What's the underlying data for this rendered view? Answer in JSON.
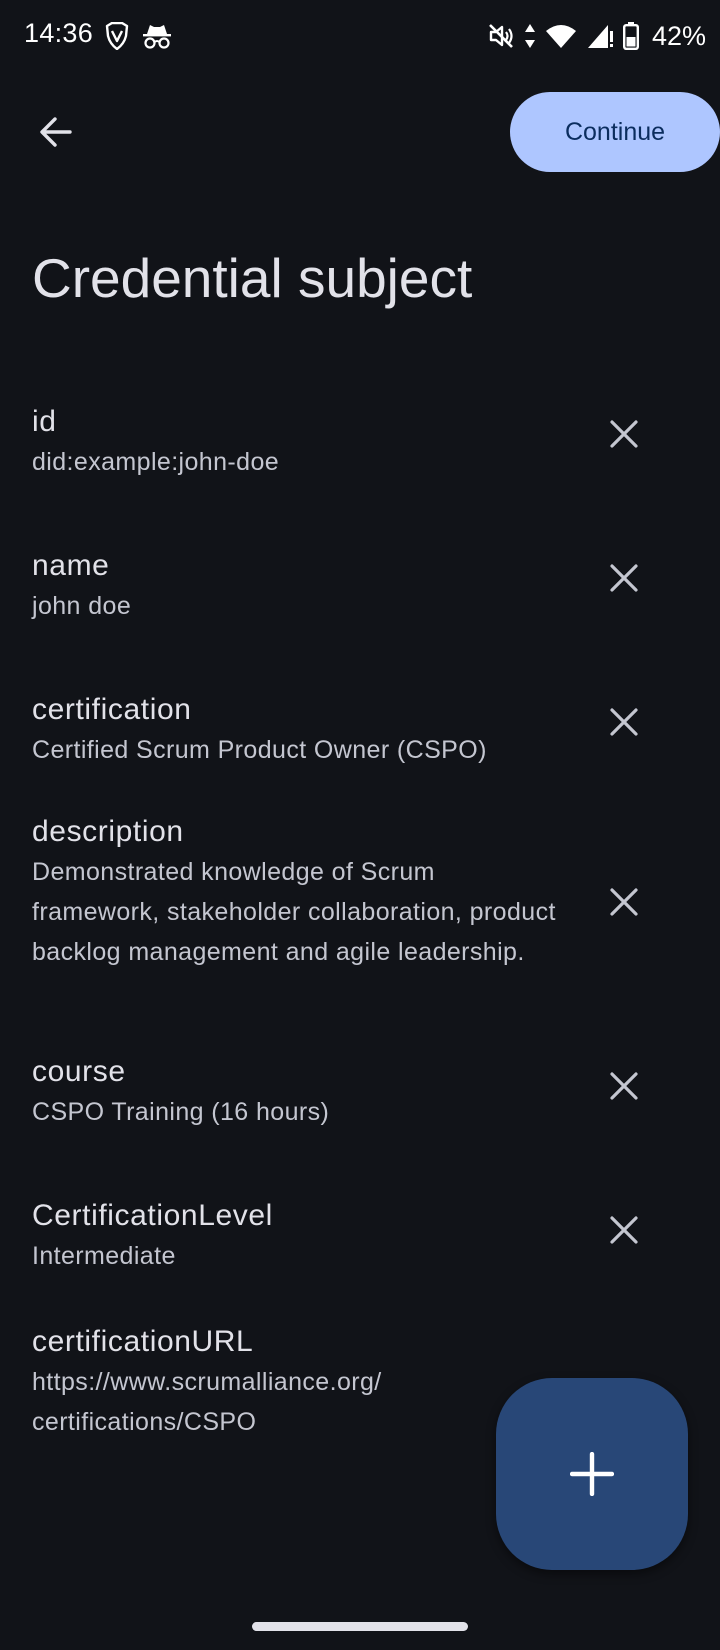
{
  "status_bar": {
    "time": "14:36",
    "battery_percent": "42%",
    "left_icons": [
      "brave-icon",
      "incognito-icon"
    ],
    "right_icons": [
      "mute-vibrate-icon",
      "data-arrows-icon",
      "wifi-icon",
      "signal-icon",
      "battery-icon"
    ]
  },
  "app_bar": {
    "back_icon": "arrow-back-icon",
    "continue_label": "Continue"
  },
  "page": {
    "title": "Credential subject"
  },
  "fields": [
    {
      "key": "id",
      "value": "did:example:john-doe",
      "removable": true
    },
    {
      "key": "name",
      "value": "john doe",
      "removable": true
    },
    {
      "key": "certification",
      "value": "Certified Scrum Product Owner (CSPO)",
      "removable": true
    },
    {
      "key": "description",
      "value": "Demonstrated knowledge of Scrum framework, stakeholder collaboration, product backlog management and agile leadership.",
      "removable": true
    },
    {
      "key": "course",
      "value": "CSPO Training (16 hours)",
      "removable": true
    },
    {
      "key": "CertificationLevel",
      "value": "Intermediate",
      "removable": true
    },
    {
      "key": "certificationURL",
      "value": "https://www.scrumalliance.org/ certifications/CSPO",
      "removable": false
    }
  ],
  "fab": {
    "icon": "add-icon"
  },
  "colors": {
    "background": "#111318",
    "primary_button": "#aec6ff",
    "fab": "#284777",
    "text_primary": "#e2e2e9",
    "text_secondary": "#c4c6d0"
  }
}
